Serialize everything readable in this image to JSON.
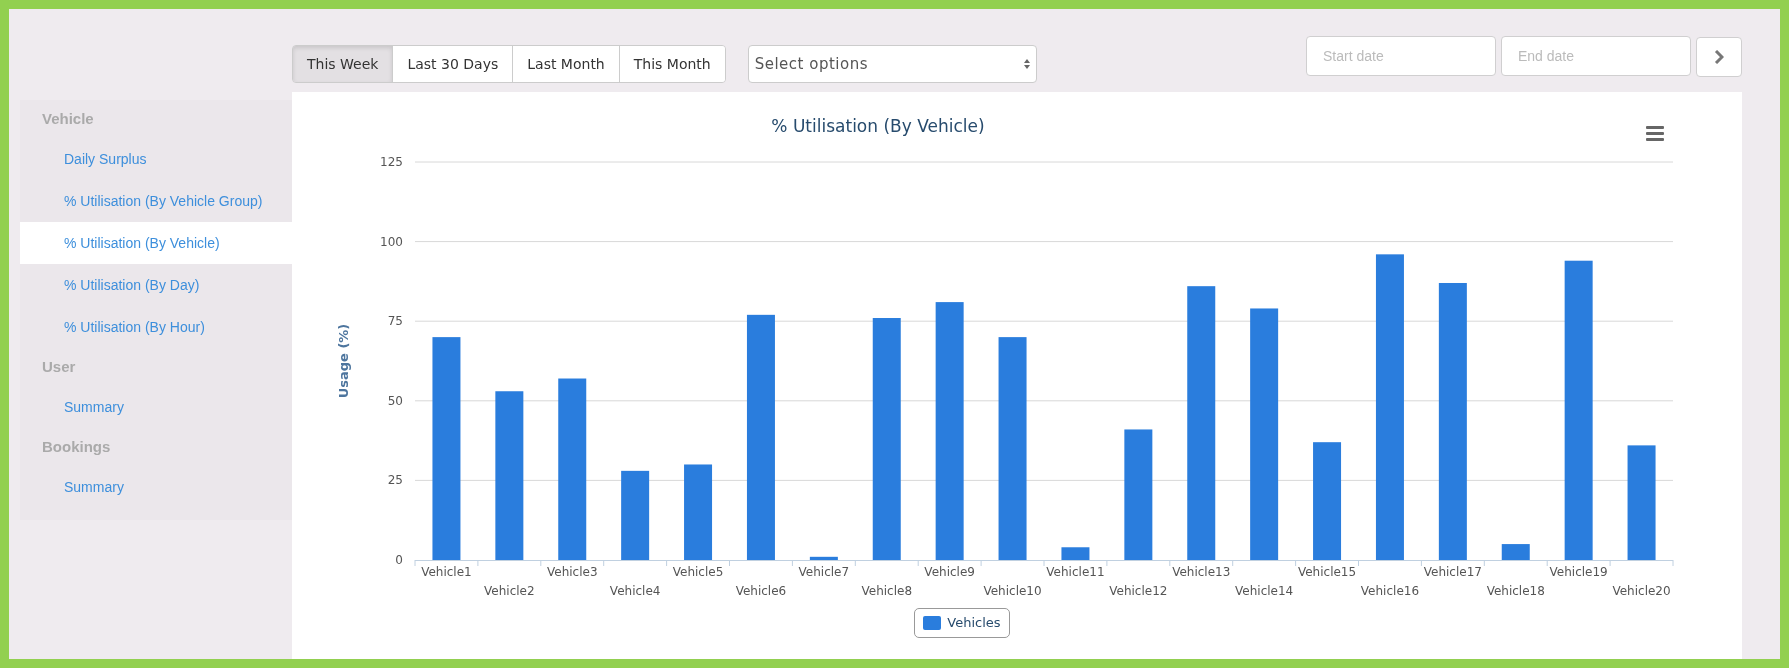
{
  "sidebar": {
    "sections": [
      {
        "title": "Vehicle",
        "items": [
          {
            "label": "Daily Surplus",
            "selected": false
          },
          {
            "label": "% Utilisation (By Vehicle Group)",
            "selected": false
          },
          {
            "label": "% Utilisation (By Vehicle)",
            "selected": true
          },
          {
            "label": "% Utilisation (By Day)",
            "selected": false
          },
          {
            "label": "% Utilisation (By Hour)",
            "selected": false
          }
        ]
      },
      {
        "title": "User",
        "items": [
          {
            "label": "Summary",
            "selected": false
          }
        ]
      },
      {
        "title": "Bookings",
        "items": [
          {
            "label": "Summary",
            "selected": false
          }
        ]
      }
    ]
  },
  "range_buttons": [
    {
      "label": "This Week",
      "selected": true
    },
    {
      "label": "Last 30 Days",
      "selected": false
    },
    {
      "label": "Last Month",
      "selected": false
    },
    {
      "label": "This Month",
      "selected": false
    }
  ],
  "select": {
    "placeholder": "Select options"
  },
  "start_date": {
    "placeholder": "Start date"
  },
  "end_date": {
    "placeholder": "End date"
  },
  "chart": {
    "chart_data": {
      "type": "bar",
      "title": "% Utilisation (By Vehicle)",
      "ylabel": "Usage (%)",
      "categories": [
        "Vehicle1",
        "Vehicle2",
        "Vehicle3",
        "Vehicle4",
        "Vehicle5",
        "Vehicle6",
        "Vehicle7",
        "Vehicle8",
        "Vehicle9",
        "Vehicle10",
        "Vehicle11",
        "Vehicle12",
        "Vehicle13",
        "Vehicle14",
        "Vehicle15",
        "Vehicle16",
        "Vehicle17",
        "Vehicle18",
        "Vehicle19",
        "Vehicle20"
      ],
      "series": [
        {
          "name": "Vehicles",
          "color": "#2a7ddd",
          "values": [
            70,
            53,
            57,
            28,
            30,
            77,
            1,
            76,
            81,
            70,
            4,
            41,
            86,
            79,
            37,
            96,
            87,
            5,
            94,
            36
          ]
        }
      ],
      "ylim": [
        0,
        125
      ],
      "grid": true,
      "yticks": [
        0,
        25,
        50,
        75,
        100,
        125
      ]
    }
  }
}
